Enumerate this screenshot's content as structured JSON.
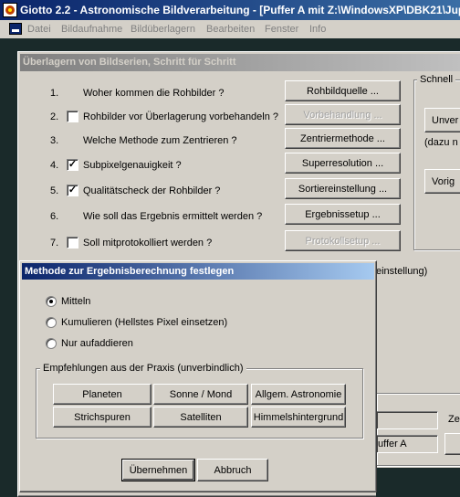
{
  "app": {
    "title": "Giotto 2.2 - Astronomische Bildverarbeitung - [Puffer A mit Z:\\WindowsXP\\DBK21\\Jup",
    "menu": [
      "Datei",
      "Bildaufnahme",
      "Bildüberlagern",
      "Bearbeiten",
      "Fenster",
      "Info"
    ]
  },
  "main_dialog": {
    "title": "Überlagern von Bildserien, Schritt für Schritt",
    "steps": [
      {
        "num": "1.",
        "question": "Woher kommen die Rohbilder ?",
        "button": "Rohbildquelle ...",
        "has_checkbox": false,
        "checked": false,
        "enabled": true
      },
      {
        "num": "2.",
        "question": "Rohbilder vor Überlagerung vorbehandeln ?",
        "button": "Vorbehandlung ...",
        "has_checkbox": true,
        "checked": false,
        "enabled": false
      },
      {
        "num": "3.",
        "question": "Welche Methode zum Zentrieren ?",
        "button": "Zentriermethode ...",
        "has_checkbox": false,
        "checked": false,
        "enabled": true
      },
      {
        "num": "4.",
        "question": "Subpixelgenauigkeit ?",
        "button": "Superresolution ...",
        "has_checkbox": true,
        "checked": true,
        "enabled": true
      },
      {
        "num": "5.",
        "question": "Qualitätscheck der Rohbilder ?",
        "button": "Sortiereinstellung ...",
        "has_checkbox": true,
        "checked": true,
        "enabled": true
      },
      {
        "num": "6.",
        "question": "Wie soll das Ergebnis ermittelt werden ?",
        "button": "Ergebnissetup ...",
        "has_checkbox": false,
        "checked": false,
        "enabled": true
      },
      {
        "num": "7.",
        "question": "Soll mitprotokolliert werden ?",
        "button": "Protokollsetup ...",
        "has_checkbox": true,
        "checked": false,
        "enabled": false
      }
    ],
    "right_group_title": "Schnell",
    "right_btn1": "Unver",
    "right_note": "(dazu n",
    "right_btn2": "Vorig",
    "partial_einstellung": "einstellung)",
    "partial_ze": "Ze",
    "partial_puffer": "uffer A"
  },
  "modal": {
    "title": "Methode zur Ergebnisberechnung festlegen",
    "options": [
      {
        "label": "Mitteln",
        "selected": true
      },
      {
        "label": "Kumulieren (Hellstes Pixel einsetzen)",
        "selected": false
      },
      {
        "label": "Nur aufaddieren",
        "selected": false
      }
    ],
    "group_title": "Empfehlungen aus der Praxis (unverbindlich)",
    "presets": [
      "Planeten",
      "Sonne / Mond",
      "Allgem. Astronomie",
      "Strichspuren",
      "Satelliten",
      "Himmelshintergrund"
    ],
    "ok": "Übernehmen",
    "cancel": "Abbruch"
  },
  "colors": {
    "app_title_bg": "#0a246a",
    "active_caption_start": "#0a246a",
    "active_caption_end": "#a6caf0",
    "inactive_caption_start": "#808080",
    "inactive_caption_end": "#c0c0c0"
  }
}
